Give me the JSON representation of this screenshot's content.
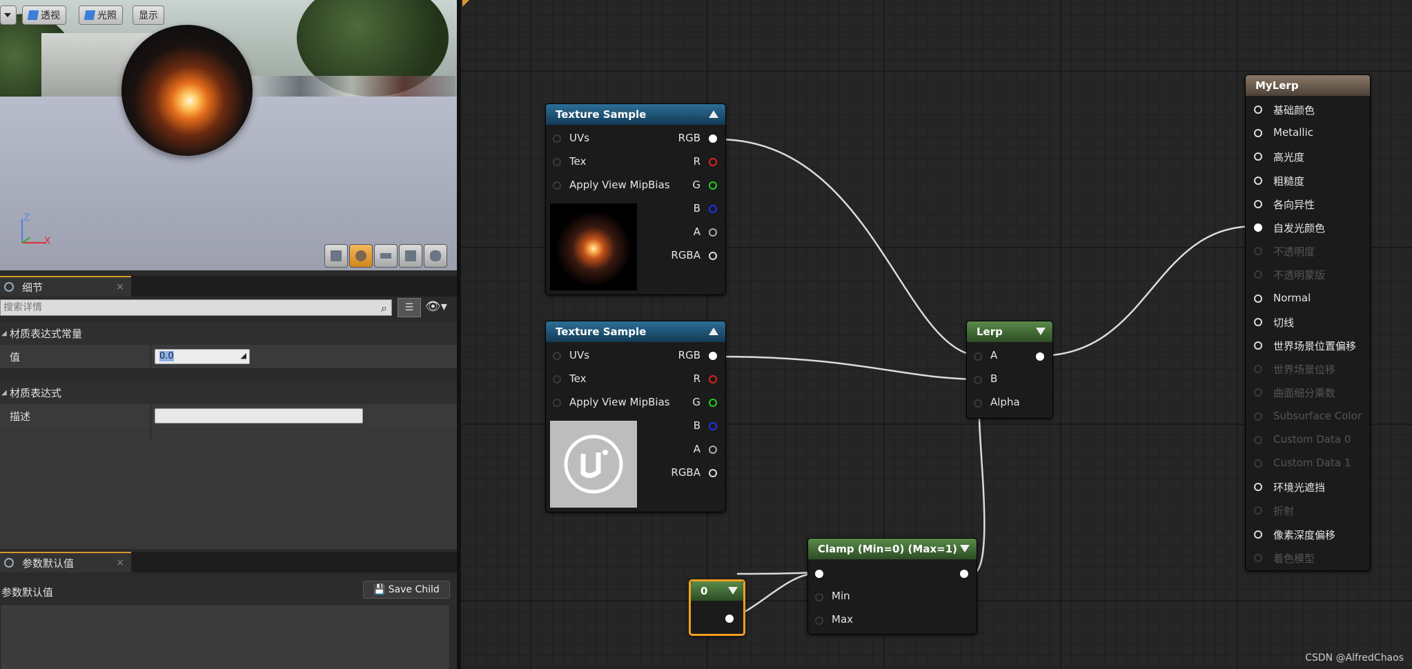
{
  "viewport": {
    "perspective_label": "透视",
    "lit_label": "光照",
    "show_label": "显示",
    "axis_z": "Z",
    "axis_x": "X"
  },
  "details_tab": {
    "title": "细节"
  },
  "search": {
    "placeholder": "搜索详情"
  },
  "details": {
    "cat1": "材质表达式常量",
    "value_label": "值",
    "value": "0.0",
    "cat2": "材质表达式",
    "desc_label": "描述",
    "desc_value": ""
  },
  "params_tab": {
    "title": "参数默认值"
  },
  "params": {
    "heading": "参数默认值",
    "save_child": "Save Child"
  },
  "nodes": {
    "tex1": {
      "title": "Texture Sample",
      "inputs": [
        "UVs",
        "Tex",
        "Apply View MipBias"
      ],
      "outputs": [
        "RGB",
        "R",
        "G",
        "B",
        "A",
        "RGBA"
      ]
    },
    "tex2": {
      "title": "Texture Sample",
      "inputs": [
        "UVs",
        "Tex",
        "Apply View MipBias"
      ],
      "outputs": [
        "RGB",
        "R",
        "G",
        "B",
        "A",
        "RGBA"
      ]
    },
    "lerp": {
      "title": "Lerp",
      "inputs": [
        "A",
        "B",
        "Alpha"
      ]
    },
    "clamp": {
      "title": "Clamp (Min=0) (Max=1)",
      "inputs": [
        "Min",
        "Max"
      ]
    },
    "const": {
      "title": "0"
    },
    "mylerp": {
      "title": "MyLerp",
      "pins": [
        "基础颜色",
        "Metallic",
        "高光度",
        "粗糙度",
        "各向异性",
        "自发光颜色",
        "不透明度",
        "不透明蒙版",
        "Normal",
        "切线",
        "世界场景位置偏移",
        "世界场景位移",
        "曲面细分乘数",
        "Subsurface Color",
        "Custom Data 0",
        "Custom Data 1",
        "环境光遮挡",
        "折射",
        "像素深度偏移",
        "着色模型"
      ]
    }
  },
  "watermark": "CSDN @AlfredChaos",
  "colors": {
    "accent": "#d69a2d",
    "header_blue": "#1f5a80",
    "header_green": "#4a7a3c",
    "header_tan": "#7a6a5a"
  }
}
